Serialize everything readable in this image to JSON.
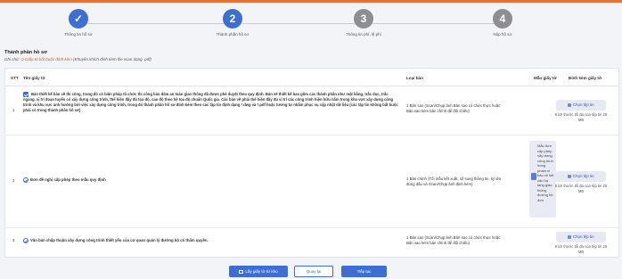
{
  "steps": [
    {
      "number": "✓",
      "label": "Thông tin hồ sơ",
      "state": "done"
    },
    {
      "number": "2",
      "label": "Thành phần hồ sơ",
      "state": "active"
    },
    {
      "number": "3",
      "label": "Thông tin phí, lệ phí",
      "state": "todo"
    },
    {
      "number": "4",
      "label": "Nộp hồ sơ",
      "state": "todo"
    }
  ],
  "section": {
    "title": "Thành phần hồ sơ",
    "note_prefix": "Ghi chú:",
    "note_required": "Giấy tờ bắt buộc đính kèm",
    "note_rest": "(Khuyến khích đính kèm file scan dạng .pdf)"
  },
  "table": {
    "headers": {
      "stt": "STT",
      "name": "Tên giấy tờ",
      "type": "Loại bản",
      "template": "Mẫu giấy tờ",
      "attach": "Đính kèm giấy tờ"
    },
    "rows": [
      {
        "stt": "1",
        "name": "Bản thiết kế bản vẽ thi công, trong đó có biện pháp tổ chức thi công bảo đảm an toàn giao thông đã được phê duyệt theo quy định. Bản vẽ thiết kế bao gồm các thành phần như mặt bằng, trắc dọc, trắc ngang, vị trí đoạn tuyến có xây dựng công trình, thể hiện đầy đủ tọa độ, cao độ theo hệ tọa độ chuẩn Quốc gia. Các bản vẽ phải thể hiện đầy đủ vị trí các công trình hiện hữu nằm trong khu vực xây dựng công trình và khu vực ảnh hưởng bởi việc xây dựng công trình, trong đó thành phần hồ sơ đính kèm theo các tập tin định dạng *.dwg và *.pdf hoặc tương tự nhằm phục vụ cập nhật dữ liệu (các tập tin không bắt buộc phải có trong thành phần hồ sơ)",
        "type": "1 Bản sao (Scan/Chụp ảnh Bản sao có chức thực hoặc Bản sao kèm bản chính để đối chiếu)",
        "attach_label": "Chọn tệp tin",
        "attach_note": "Kích thước tối đa của tệp tin 25 MB"
      },
      {
        "stt": "2",
        "name": "Đơn đề nghị cấp phép theo mẫu quy định",
        "type": "1 Bản chính (Tối mẫu kết xuất, số sung thông tin, ký tên đúng dấu và Scan/Chụp ảnh định kèm)",
        "template": "Mẫu đơn cấp phép xây dựng công trình trong phạm vi bảo vệ kết cấu hạ tầng giao thông đường bộ đơn",
        "attach_label": "Chọn tệp tin",
        "attach_note": "Kích thước tối đa của tệp tin 25 MB"
      },
      {
        "stt": "3",
        "name": "Văn bản chấp thuận xây dựng công trình thiết yếu của cơ quan quản lý đường bộ có thẩm quyền.",
        "type": "1 Bản sao (Scan/Chụp ảnh Bản sao có chức thực hoặc Bản sao kèm bản chính để đối chiếu)",
        "attach_label": "Chọn tệp tin",
        "attach_note": "Kích thước tối đa của tệp tin 25 MB"
      }
    ]
  },
  "footer": {
    "kho_label": "Lấy giấy tờ từ kho",
    "back_label": "Quay lại",
    "next_label": "Tiếp tục"
  }
}
